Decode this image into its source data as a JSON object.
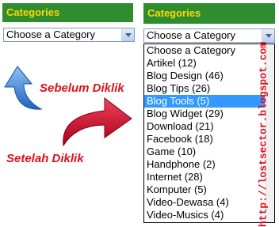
{
  "left_widget": {
    "header": "Categories",
    "select_value": "Choose a Category"
  },
  "right_widget": {
    "header": "Categories",
    "select_value": "Choose a Category",
    "options": [
      "Choose a Category",
      "Artikel (12)",
      "Blog Design (46)",
      "Blog Tips (26)",
      "Blog Tools (5)",
      "Blog Widget (29)",
      "Download (21)",
      "Facebook (18)",
      "Game (10)",
      "Handphone (2)",
      "Internet (28)",
      "Komputer (5)",
      "Video-Dewasa (4)",
      "Video-Musics (4)"
    ],
    "highlighted_index": 4
  },
  "annotations": {
    "before_click": "Sebelum Diklik",
    "after_click": "Setelah Diklik",
    "watermark": "http://lostsector.blogspot.com"
  },
  "colors": {
    "header_bg": "#2e8d2e",
    "header_text": "#ffd800",
    "highlight": "#3399ff",
    "annotation_text": "#e0101a",
    "blue_arrow": "#2f7fd6",
    "red_arrow": "#d0102a"
  },
  "icons": {
    "blue_arrow": "curved-up-arrow-icon",
    "red_arrow": "curved-right-arrow-icon"
  }
}
